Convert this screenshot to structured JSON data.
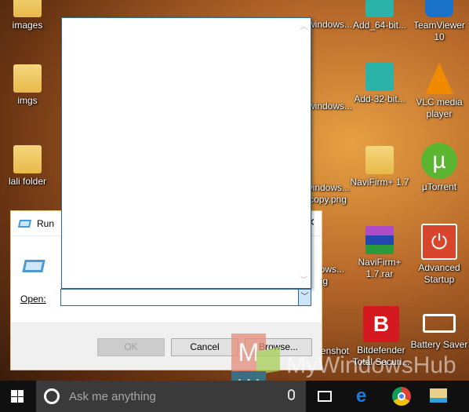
{
  "desktop": {
    "icons": [
      {
        "label": "images",
        "kind": "folder"
      },
      {
        "label": "imgs",
        "kind": "folder"
      },
      {
        "label": "lali folder",
        "kind": "folder"
      },
      {
        "label": "windows...",
        "kind": "image"
      },
      {
        "label": "windows...",
        "kind": "image"
      },
      {
        "label": "windows... copy.png",
        "kind": "image"
      },
      {
        "label": "windows... png",
        "kind": "image"
      },
      {
        "label": "screenshot...",
        "kind": "image"
      },
      {
        "label": "Add_64-bit...",
        "kind": "registry"
      },
      {
        "label": "Add-32-bit...",
        "kind": "registry"
      },
      {
        "label": "NaviFirm+ 1.7",
        "kind": "folder"
      },
      {
        "label": "NaviFirm+ 1.7.rar",
        "kind": "winrar"
      },
      {
        "label": "Bitdefender Total Securi...",
        "kind": "bitdefender"
      },
      {
        "label": "TeamViewer 10",
        "kind": "teamviewer"
      },
      {
        "label": "VLC media player",
        "kind": "vlc"
      },
      {
        "label": "µTorrent",
        "kind": "utorrent"
      },
      {
        "label": "Advanced Startup",
        "kind": "power"
      },
      {
        "label": "Battery Saver",
        "kind": "battery"
      }
    ]
  },
  "run_dialog": {
    "title": "Run",
    "open_label": "Open:",
    "open_value": "",
    "ok": "OK",
    "cancel": "Cancel",
    "browse": "Browse..."
  },
  "taskbar": {
    "search_placeholder": "Ask me anything",
    "pinned": [
      "task-view",
      "edge",
      "chrome",
      "file-explorer"
    ]
  },
  "watermark": "MyWindowsHub"
}
